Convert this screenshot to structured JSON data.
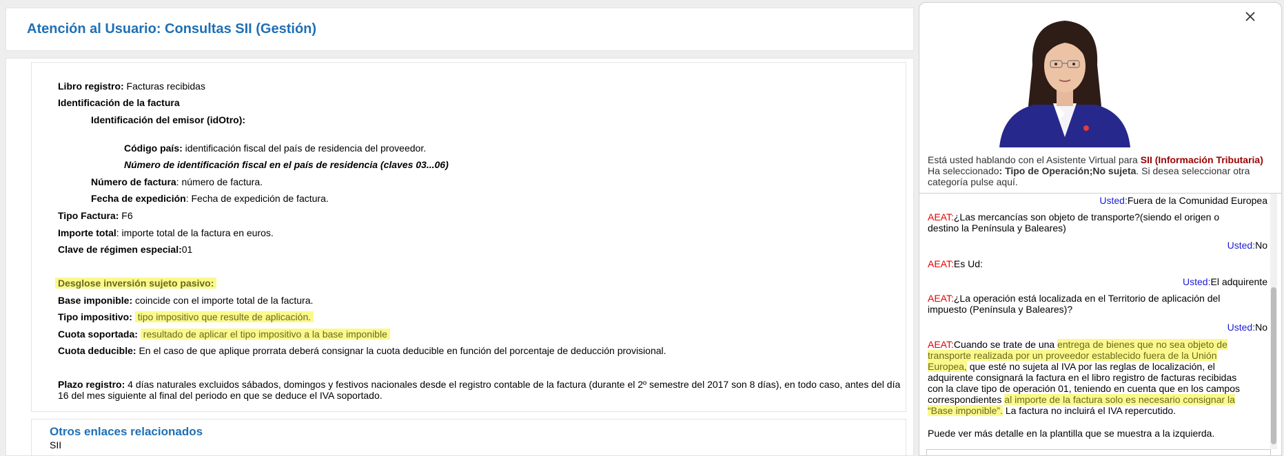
{
  "header": {
    "title": "Atención al Usuario: Consultas SII (Gestión)"
  },
  "content": {
    "libro_label": "Libro registro:",
    "libro_value": " Facturas recibidas",
    "identificacion_factura": "Identificación de la factura",
    "identificacion_emisor": "Identificación del emisor (idOtro):",
    "codigo_pais_label": "Código país:",
    "codigo_pais_value": " identificación fiscal del país de residencia del proveedor.",
    "numero_identificacion": "Número de identificación fiscal en el país de residencia (claves 03...06)",
    "numero_factura_label": "Número de factura",
    "numero_factura_value": ": número de factura.",
    "fecha_label": "Fecha de expedición",
    "fecha_value": ": Fecha de expedición de factura.",
    "tipo_factura_label": "Tipo Factura:",
    "tipo_factura_value": " F6",
    "importe_label": "Importe total",
    "importe_value": ": importe total de la factura en euros.",
    "clave_label": "Clave de régimen especial:",
    "clave_value": "01",
    "desglose": "Desglose inversión sujeto pasivo:",
    "base_label": "Base imponible:",
    "base_value": " coincide con el importe total de la factura.",
    "tipo_imp_label": "Tipo impositivo:",
    "tipo_imp_value": "tipo impositivo que resulte de aplicación.",
    "cuota_sop_label": "Cuota soportada:",
    "cuota_sop_value": "resultado de aplicar el tipo impositivo a la base imponible",
    "cuota_ded_label": "Cuota deducible:",
    "cuota_ded_value": " En el caso de que aplique prorrata deberá consignar la cuota deducible en función del porcentaje de deducción provisional.",
    "plazo_label": "Plazo registro:",
    "plazo_value": " 4 días naturales excluidos sábados, domingos y festivos nacionales desde el registro contable de la factura (durante el 2º semestre del 2017 son 8 días), en todo caso, antes del día 16 del mes siguiente al final del periodo en que se deduce el IVA soportado."
  },
  "links": {
    "title": "Otros enlaces relacionados",
    "sub": "SII"
  },
  "assistant": {
    "intro_1": "Está usted hablando con el Asistente Virtual para ",
    "intro_sii": "SII (Información Tributaria)",
    "intro_2": "Ha seleccionado",
    "intro_sel": ": Tipo de Operación;No sujeta",
    "intro_3": ". Si desea seleccionar otra categoría pulse aquí.",
    "aeat_tag": "AEAT:",
    "usted_tag": "Usted:",
    "msgs": {
      "u1": "Fuera de la Comunidad Europea",
      "b1": "¿Las mercancías son objeto de transporte?(siendo el origen o destino la Península y Baleares)",
      "u2": "No",
      "b2": "Es Ud:",
      "u3": "El adquirente",
      "b3": "¿La operación está localizada en el Territorio de aplicación del impuesto (Península y Baleares)?",
      "u4": "No",
      "b4_a": "Cuando se trate de una ",
      "b4_hl1": "entrega de bienes que no sea objeto de transporte realizada por un proveedor establecido fuera de la Unión Europea,",
      "b4_b": " que esté no sujeta al IVA por las reglas de localización, el adquirente consignará la factura en el libro registro de facturas recibidas con la clave tipo de operación 01, teniendo en cuenta que en los campos correspondientes ",
      "b4_hl2": "al importe de la factura solo es necesario consignar la “Base imponible”.",
      "b4_c": " La factura no incluirá el IVA repercutido.",
      "b5": "Puede ver más detalle en la plantilla que se muestra a la izquierda."
    }
  },
  "colors": {
    "accent": "#1f6fb5",
    "highlight": "#fbf98c",
    "aeat": "#e30000",
    "usted": "#1b1bd6",
    "sii": "#990000"
  }
}
